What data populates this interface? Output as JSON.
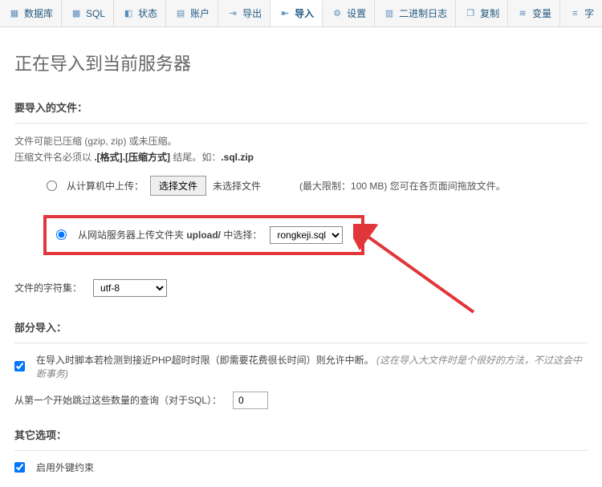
{
  "tabs": {
    "database": "数据库",
    "sql": "SQL",
    "status": "状态",
    "accounts": "账户",
    "export": "导出",
    "import": "导入",
    "settings": "设置",
    "binlog": "二进制日志",
    "copy": "复制",
    "variables": "变量",
    "char": "字"
  },
  "heading": "正在导入到当前服务器",
  "sections": {
    "file_to_import": "要导入的文件：",
    "partial_import": "部分导入：",
    "other_options": "其它选项："
  },
  "file_desc_line1": "文件可能已压缩 (gzip, zip) 或未压缩。",
  "file_desc_line2_a": "压缩文件名必须以 ",
  "file_desc_line2_b": ".[格式].[压缩方式]",
  "file_desc_line2_c": " 结尾。如：",
  "file_desc_line2_d": ".sql.zip",
  "upload_from_computer": "从计算机中上传：",
  "choose_file_btn": "选择文件",
  "no_file_selected": "未选择文件",
  "max_limit_hint": "(最大限制：100 MB) 您可在各页面间拖放文件。",
  "upload_from_server_a": "从网站服务器上传文件夹 ",
  "upload_from_server_b": "upload/",
  "upload_from_server_c": " 中选择：",
  "server_file_selected": "rongkeji.sql",
  "server_file_options": [
    "rongkeji.sql"
  ],
  "charset_label": "文件的字符集：",
  "charset_value": "utf-8",
  "charset_options": [
    "utf-8"
  ],
  "partial_desc_a": "在导入时脚本若检测到接近PHP超时时限（即需要花费很长时间）则允许中断。",
  "partial_desc_b": "(这在导入大文件时是个很好的方法，不过这会中断事务)",
  "skip_queries_label": "从第一个开始跳过这些数量的查询（对于SQL）：",
  "skip_queries_value": "0",
  "enable_fk_label": "启用外键约束"
}
